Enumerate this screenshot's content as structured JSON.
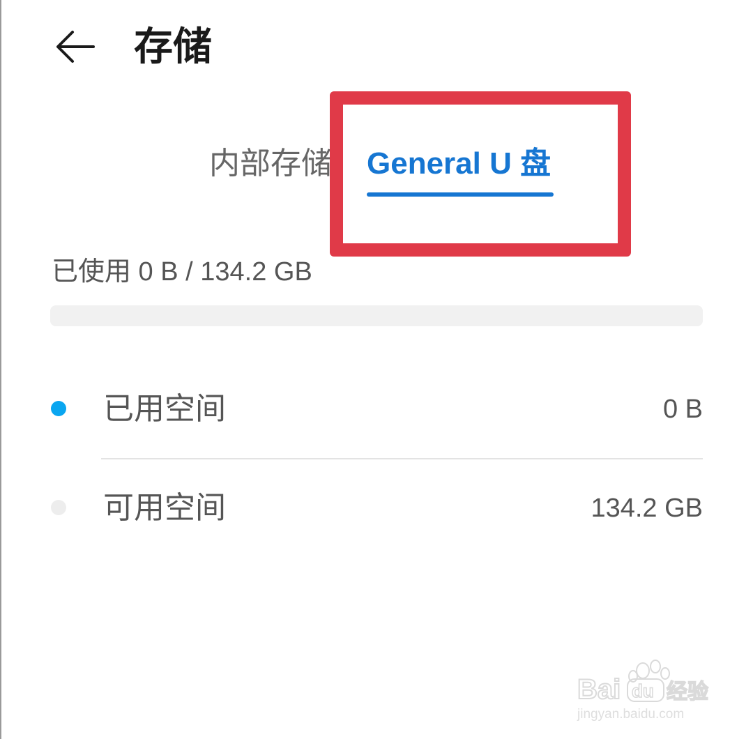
{
  "header": {
    "title": "存储",
    "back_icon": "arrow-left-icon"
  },
  "tabs": [
    {
      "label": "内部存储",
      "selected": false
    },
    {
      "label": "General U 盘",
      "selected": true
    }
  ],
  "usage": {
    "summary": "已使用 0 B / 134.2 GB",
    "used_fraction": 0
  },
  "legend": [
    {
      "label": "已用空间",
      "value": "0 B",
      "dot_color": "#0aa6f0"
    },
    {
      "label": "可用空间",
      "value": "134.2 GB",
      "dot_color": "#ededed"
    }
  ],
  "colors": {
    "accent": "#1676d2",
    "annotation_red": "#e03a48",
    "used_dot": "#0aa6f0",
    "free_dot": "#ededed"
  },
  "watermark": {
    "brand": "Baidu经验",
    "url": "jingyan.baidu.com"
  }
}
